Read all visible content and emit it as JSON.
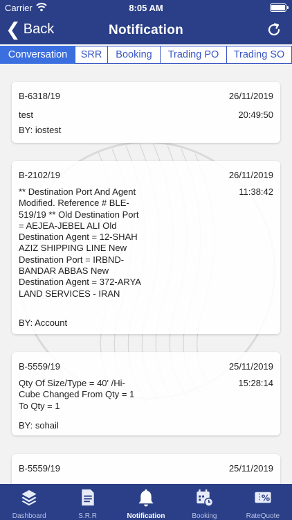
{
  "status_bar": {
    "carrier": "Carrier",
    "time": "8:05 AM"
  },
  "nav": {
    "back_label": "Back",
    "title": "Notification"
  },
  "tabs": [
    {
      "label": "Conversation",
      "active": true
    },
    {
      "label": "SRR"
    },
    {
      "label": "Booking"
    },
    {
      "label": "Trading PO"
    },
    {
      "label": "Trading SO"
    }
  ],
  "notifications": [
    {
      "ref": "B-6318/19",
      "date": "26/11/2019",
      "time": "20:49:50",
      "message": "test",
      "by": "BY: iostest"
    },
    {
      "ref": "B-2102/19",
      "date": "26/11/2019",
      "time": "11:38:42",
      "message": "** Destination Port And Agent Modified. Reference # BLE-519/19 ** Old Destination Port = AEJEA-JEBEL ALI Old Destination Agent = 12-SHAH AZIZ SHIPPING LINE New Destination Port = IRBND-BANDAR ABBAS New Destination Agent = 372-ARYA LAND SERVICES - IRAN",
      "by": "BY: Account"
    },
    {
      "ref": "B-5559/19",
      "date": "25/11/2019",
      "time": "15:28:14",
      "message": "Qty Of Size/Type = 40' /Hi-Cube Changed From Qty = 1 To Qty = 1",
      "by": "BY: sohail"
    },
    {
      "ref": "B-5559/19",
      "date": "25/11/2019"
    }
  ],
  "tab_bar": [
    {
      "label": "Dashboard",
      "icon": "layers-icon"
    },
    {
      "label": "S.R.R",
      "icon": "document-icon"
    },
    {
      "label": "Notification",
      "icon": "bell-icon",
      "active": true
    },
    {
      "label": "Booking",
      "icon": "calendar-icon"
    },
    {
      "label": "RateQuote",
      "icon": "percent-ticket-icon"
    }
  ],
  "colors": {
    "header": "#2a3f88",
    "accent": "#3b6fe0",
    "tab_border": "#3a56c4"
  }
}
